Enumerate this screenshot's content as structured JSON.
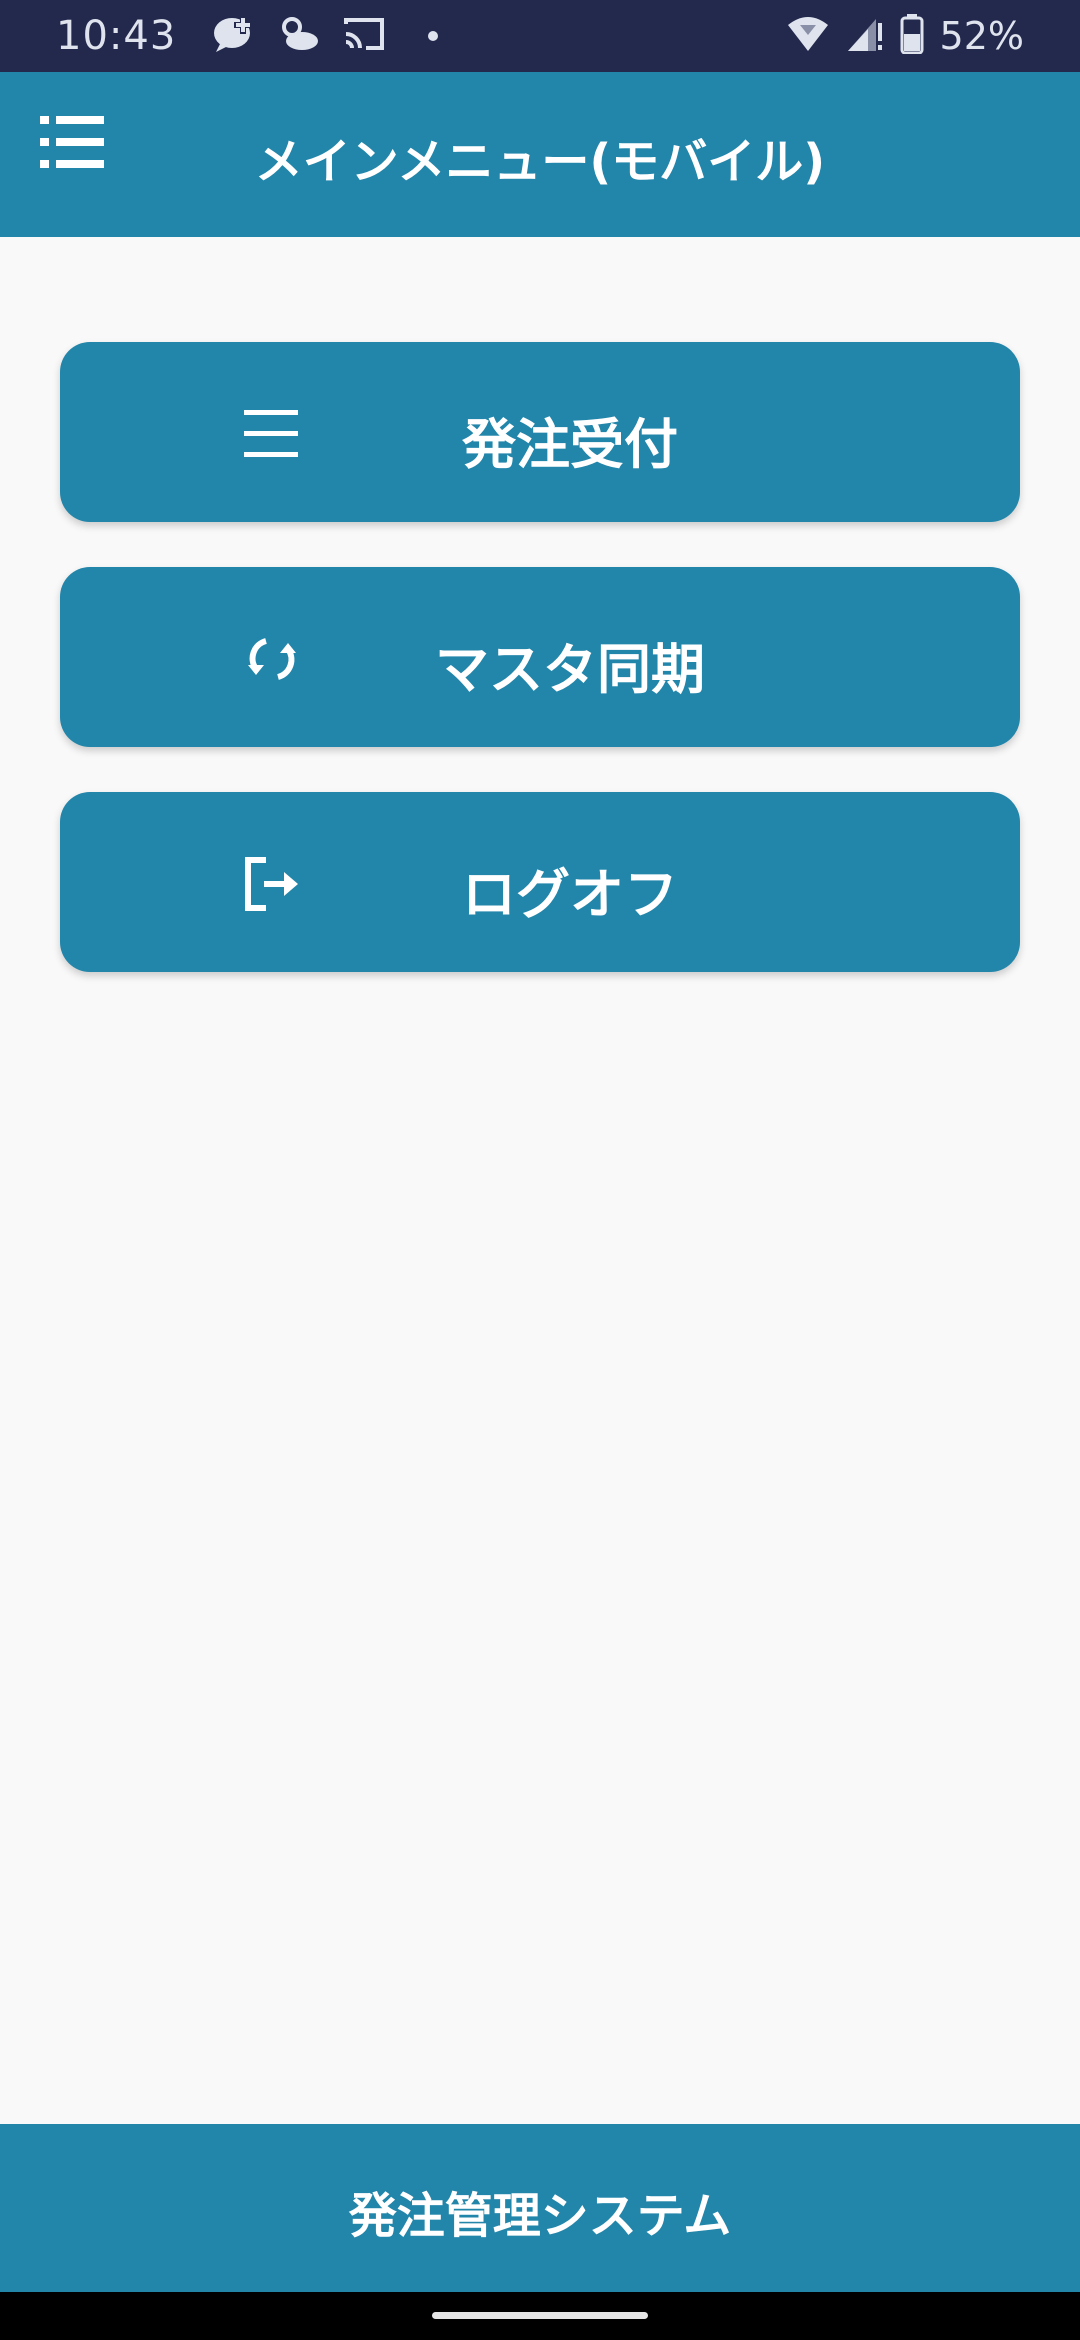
{
  "status_bar": {
    "time": "10:43",
    "battery": "52%",
    "icons_left": [
      "chat-add-icon",
      "weather-icon",
      "cast-icon",
      "dot-icon"
    ],
    "icons_right": [
      "wifi-icon",
      "signal-icon",
      "battery-icon"
    ]
  },
  "app_bar": {
    "title": "メインメニュー(モバイル)",
    "menu_icon": "menu-list-icon"
  },
  "menu": {
    "items": [
      {
        "label": "発注受付",
        "icon": "list-icon"
      },
      {
        "label": "マスタ同期",
        "icon": "sync-icon"
      },
      {
        "label": "ログオフ",
        "icon": "logout-icon"
      }
    ]
  },
  "footer": {
    "text": "発注管理システム"
  },
  "colors": {
    "primary": "#2285aa",
    "status_bar": "#22294d",
    "background": "#f9f9f9"
  }
}
